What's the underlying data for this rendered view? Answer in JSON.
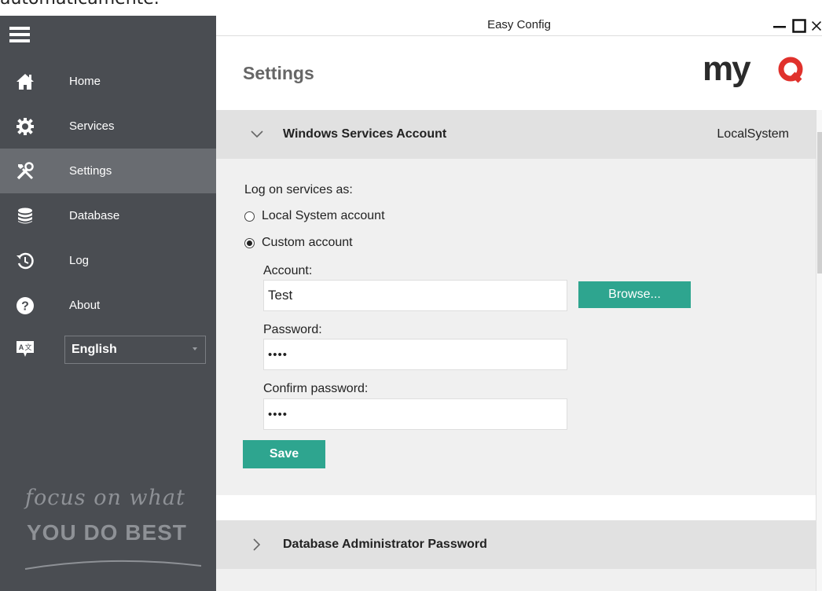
{
  "doc_text": "automaticamente.",
  "window": {
    "title": "Easy Config",
    "minimize_icon": "minimize-icon",
    "maximize_icon": "maximize-icon",
    "close_icon": "close-icon"
  },
  "sidebar": {
    "menu_icon": "hamburger-icon",
    "items": [
      {
        "label": "Home",
        "icon": "home-icon",
        "active": false
      },
      {
        "label": "Services",
        "icon": "gear-icon",
        "active": false
      },
      {
        "label": "Settings",
        "icon": "tools-icon",
        "active": true
      },
      {
        "label": "Database",
        "icon": "database-icon",
        "active": false
      },
      {
        "label": "Log",
        "icon": "history-icon",
        "active": false
      },
      {
        "label": "About",
        "icon": "help-icon",
        "active": false
      }
    ],
    "language_icon": "language-icon",
    "language": "English",
    "tagline_line1": "focus on what",
    "tagline_line2": "YOU DO BEST"
  },
  "header": {
    "page_title": "Settings",
    "logo_text": "myq"
  },
  "sections": {
    "windows_services": {
      "title": "Windows Services Account",
      "value": "LocalSystem",
      "expanded": true,
      "logon_label": "Log on services as:",
      "options": [
        "Local System account",
        "Custom account"
      ],
      "selected_option": "Custom account",
      "account_label": "Account:",
      "account_value": "Test",
      "browse_label": "Browse...",
      "password_label": "Password:",
      "password_value": "••••",
      "confirm_label": "Confirm password:",
      "confirm_value": "••••",
      "save_label": "Save"
    },
    "db_admin": {
      "title": "Database Administrator Password",
      "expanded": false
    }
  },
  "colors": {
    "sidebar_bg": "#4a4d52",
    "sidebar_active": "#696c71",
    "accent_teal": "#2ea58f",
    "logo_dark": "#2b2b2b",
    "logo_red": "#e0312c"
  }
}
